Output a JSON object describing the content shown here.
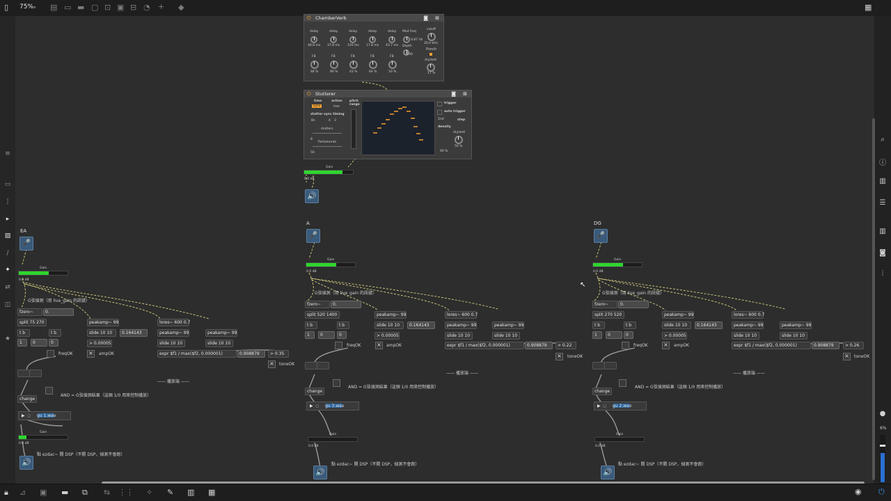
{
  "toolbar": {
    "zoom": "75%",
    "icons": [
      "sidebar-icon",
      "grid-icon",
      "present-icon",
      "lock-icon",
      "clipboard-icon",
      "box-icon",
      "align-icon",
      "snap-icon",
      "dial-icon",
      "add-icon",
      "paint-icon",
      "grid-menu-icon"
    ]
  },
  "left_sidebar": {
    "icons": [
      "list-icon",
      "browser-icon",
      "audio-icon",
      "midi-icon",
      "image-icon",
      "clip-icon",
      "plug-icon",
      "arrows-icon",
      "package-icon",
      "star-icon"
    ]
  },
  "right_sidebar": {
    "icons": [
      "search-icon",
      "info-icon",
      "book-icon",
      "list-icon",
      "reference-icon",
      "camera-icon",
      "mixer-icon",
      "record-icon"
    ],
    "cpu": "6%"
  },
  "bottom_toolbar": {
    "icons": [
      "lock-icon",
      "edit-icon",
      "presentation-icon",
      "comment-icon",
      "windows-icon",
      "connect-icon",
      "grid-icon",
      "debug-icon",
      "wrench-icon",
      "piano-icon",
      "keyboard-icon",
      "play-circle-icon",
      "power-icon"
    ]
  },
  "chamberverb": {
    "title": "ChamberVerb",
    "delay_labels": [
      "delay",
      "delay",
      "delay",
      "delay",
      "delay"
    ],
    "delay_values": [
      "48.8 ms",
      "37.8 ms",
      "120 ms",
      "17.8 ms",
      "43.7 ms"
    ],
    "fb_labels": [
      "FB",
      "FB",
      "FB",
      "FB",
      "FB"
    ],
    "fb_values": [
      "48 %",
      "90 %",
      "43 %",
      "64 %",
      "10 %"
    ],
    "modfreq_label": "Mod freq",
    "modfreq_value": "0.87 Hz",
    "depth_label": "Depth",
    "depth_value": "0.00",
    "cutoff_label": "cutoff",
    "cutoff_value": "20.0 kHz",
    "punch_label": "Punch",
    "drywet_label": "dry/wet",
    "drywet_value": "17 %"
  },
  "stutterer": {
    "title": "Stutterer",
    "time_label": "time",
    "time_value": "sync",
    "action_label": "action",
    "action_value": "free",
    "pitch_label": "pitch range",
    "sync_timing_label": "stutter sync timing",
    "sync_timing_value1": "8n",
    "sync_timing_value2": "4",
    "sync_timing_value3": "3",
    "stutters_label": "stutters",
    "stutters_value": "8",
    "portamento_label": "Portamento",
    "portamento_value": "50",
    "trigger_label": "trigger",
    "auto_trigger_label": "auto trigger",
    "step_value": "2nd",
    "step_label": "step",
    "density_label": "density",
    "density_value": "60 %",
    "drywet_label": "dry/wet",
    "drywet_value": "50 %"
  },
  "top_gain": {
    "label": "Gain",
    "db": "0.0 dB"
  },
  "patches": [
    {
      "name": "EA",
      "gain_label": "Gain",
      "db": "0.0 dB",
      "comment": "G弦偵測（用 live_gain 的訊號）",
      "fzero": "fzero~",
      "fzero_out": "0.",
      "split": "split 75 270",
      "t1": "t b",
      "t2": "t b",
      "n1": "1",
      "n2": "0",
      "n3": "0",
      "peakamp1": "peakamp~ 99",
      "slide1": "slide 10 10",
      "slide1_out": "0.164143",
      "gt1": "> 0.00005",
      "freqok": "freqOK",
      "ampok": "ampOK",
      "lores": "lores~ 600 0.7",
      "peakamp2": "peakamp~ 99",
      "peakamp3": "peakamp~ 99",
      "slide2": "slide 10 10",
      "slide3": "slide 10 10",
      "expr": "expr $f1 / max($f2, 0.000001)",
      "expr_out": "0.908879",
      "gt2": "> 0.35",
      "toneok": "toneOK",
      "player_label": "—— 播放端 ——",
      "and_comment": "AND = G弦偵測結果（這個 1/0 用來控制播放）",
      "change": "change",
      "file": "gu 1.wav",
      "gain2_label": "Gain",
      "db2": "0.0 dB",
      "dsp_comment": "點 ezdac~ 開 DSP（不開 DSP，偵測不會跑）"
    },
    {
      "name": "A",
      "gain_label": "Gain",
      "db": "0.0 dB",
      "comment": "G弦偵測（用 live_gain 的訊號）",
      "fzero": "fzero~",
      "fzero_out": "0.",
      "split": "split 520 1400",
      "t1": "t b",
      "t2": "t b",
      "n1": "1",
      "n2": "0",
      "n3": "0",
      "peakamp1": "peakamp~ 99",
      "slide1": "slide 10 10",
      "slide1_out": "0.164143",
      "gt1": "> 0.00005",
      "freqok": "freqOK",
      "ampok": "ampOK",
      "lores": "lores~ 600 0.7",
      "peakamp2": "peakamp~ 99",
      "peakamp3": "peakamp~ 99",
      "slide2": "slide 10 10",
      "slide3": "slide 10 10",
      "expr": "expr $f1 / max($f2, 0.000001)",
      "expr_out": "0.908879",
      "gt2": "> 0.22",
      "toneok": "toneOK",
      "player_label": "—— 播放端 ——",
      "and_comment": "AND = G弦偵測結果（這個 1/0 用來控制播放）",
      "change": "change",
      "file": "gu 3.wav",
      "gain2_label": "Gain",
      "db2": "0.0 dB",
      "dsp_comment": "點 ezdac~ 開 DSP（不開 DSP，偵測不會跑）"
    },
    {
      "name": "DG",
      "gain_label": "Gain",
      "db": "0.0 dB",
      "comment": "G弦偵測（用 live_gain 的訊號）",
      "fzero": "fzero~",
      "fzero_out": "0.",
      "split": "split 270 520",
      "t1": "t b",
      "t2": "t b",
      "n1": "1",
      "n2": "0",
      "n3": "0",
      "peakamp1": "peakamp~ 99",
      "slide1": "slide 10 10",
      "slide1_out": "0.164143",
      "gt1": "> 0.00005",
      "freqok": "freqOK",
      "ampok": "ampOK",
      "lores": "lores~ 600 0.7",
      "peakamp2": "peakamp~ 99",
      "peakamp3": "peakamp~ 99",
      "slide2": "slide 10 10",
      "slide3": "slide 10 10",
      "expr": "expr $f1 / max($f2, 0.000001)",
      "expr_out": "0.908879",
      "gt2": "> 0.26",
      "toneok": "toneOK",
      "player_label": "—— 播放端 ——",
      "and_comment": "AND = G弦偵測結果（這個 1/0 用來控制播放）",
      "change": "change",
      "file": "gu 2.wav",
      "gain2_label": "Gain",
      "db2": "0.0 dB",
      "dsp_comment": "點 ezdac~ 開 DSP（不開 DSP，偵測不會跑）"
    }
  ]
}
